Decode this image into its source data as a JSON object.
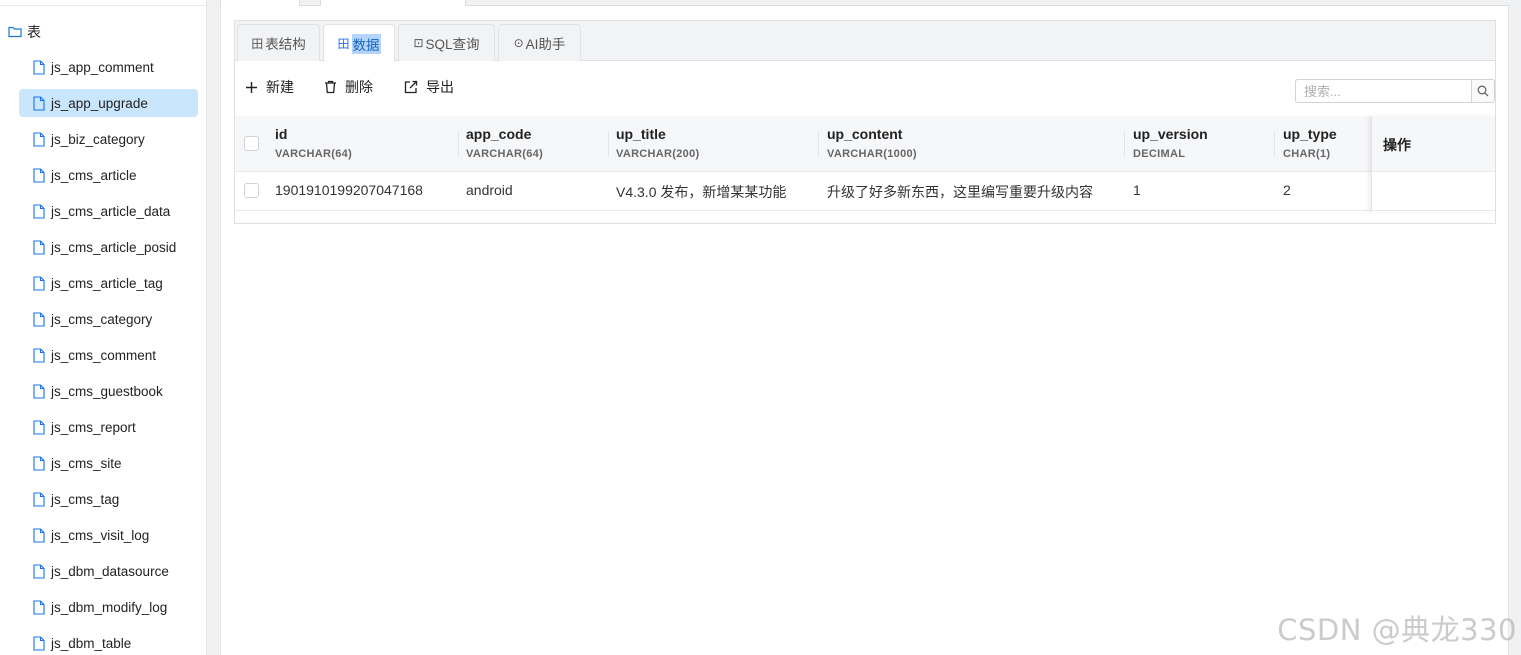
{
  "sidebar": {
    "root_label": "表",
    "items": [
      {
        "label": "js_app_comment",
        "active": false
      },
      {
        "label": "js_app_upgrade",
        "active": true
      },
      {
        "label": "js_biz_category",
        "active": false
      },
      {
        "label": "js_cms_article",
        "active": false
      },
      {
        "label": "js_cms_article_data",
        "active": false
      },
      {
        "label": "js_cms_article_posid",
        "active": false
      },
      {
        "label": "js_cms_article_tag",
        "active": false
      },
      {
        "label": "js_cms_category",
        "active": false
      },
      {
        "label": "js_cms_comment",
        "active": false
      },
      {
        "label": "js_cms_guestbook",
        "active": false
      },
      {
        "label": "js_cms_report",
        "active": false
      },
      {
        "label": "js_cms_site",
        "active": false
      },
      {
        "label": "js_cms_tag",
        "active": false
      },
      {
        "label": "js_cms_visit_log",
        "active": false
      },
      {
        "label": "js_dbm_datasource",
        "active": false
      },
      {
        "label": "js_dbm_modify_log",
        "active": false
      },
      {
        "label": "js_dbm_table",
        "active": false
      }
    ]
  },
  "tabs": [
    {
      "label": "表结构",
      "icon": "table-grid-icon",
      "active": false
    },
    {
      "label": "数据",
      "icon": "table-grid-icon",
      "active": true
    },
    {
      "label": "SQL查询",
      "icon": "terminal-icon",
      "active": false
    },
    {
      "label": "AI助手",
      "icon": "chat-bubble-icon",
      "active": false
    }
  ],
  "toolbar": {
    "new_label": "新建",
    "delete_label": "删除",
    "export_label": "导出",
    "search_placeholder": "搜索..."
  },
  "table": {
    "columns": [
      {
        "name": "id",
        "type": "VARCHAR(64)"
      },
      {
        "name": "app_code",
        "type": "VARCHAR(64)"
      },
      {
        "name": "up_title",
        "type": "VARCHAR(200)"
      },
      {
        "name": "up_content",
        "type": "VARCHAR(1000)"
      },
      {
        "name": "up_version",
        "type": "DECIMAL"
      },
      {
        "name": "up_type",
        "type": "CHAR(1)"
      }
    ],
    "actions_header": "操作",
    "rows": [
      [
        "1901910199207047168",
        "android",
        "V4.3.0 发布，新增某某功能",
        "升级了好多新东西，这里编写重要升级内容",
        "1",
        "2"
      ]
    ]
  },
  "watermark": "CSDN @典龙330",
  "colors": {
    "accent": "#1a73e8",
    "selected_item_bg": "#c9e6fd",
    "header_bg": "#f6f7f9"
  }
}
